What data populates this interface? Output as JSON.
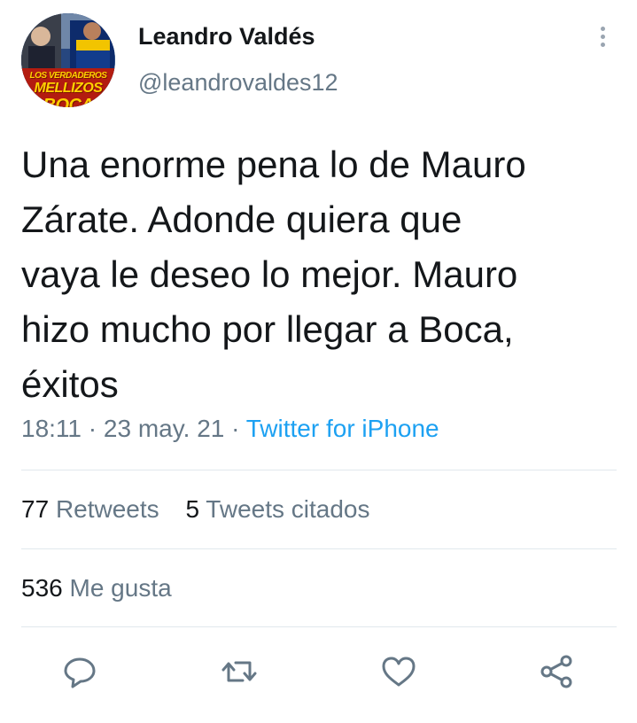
{
  "author": {
    "name": "Leandro Valdés",
    "handle": "@leandrovaldes12",
    "avatar_icon": "profile-picture-boca-collage",
    "avatar_text": [
      "LOS VERDADEROS",
      "MELLIZOS",
      "BOCA"
    ]
  },
  "tweet": {
    "text": "Una enorme pena lo de Mauro\nZárate. Adonde quiera que\nvaya le deseo lo mejor. Mauro\nhizo mucho por llegar a Boca,\néxitos",
    "time": "18:11",
    "sep1": "·",
    "date": "23 may. 21",
    "sep2": "·",
    "source": "Twitter for iPhone"
  },
  "stats": {
    "retweets_count": "77",
    "retweets_label": "Retweets",
    "quotes_count": "5",
    "quotes_label": "Tweets citados",
    "likes_count": "536",
    "likes_label": "Me gusta"
  },
  "actions": [
    {
      "icon": "reply-icon"
    },
    {
      "icon": "retweet-icon"
    },
    {
      "icon": "like-icon"
    },
    {
      "icon": "share-icon"
    }
  ],
  "colors": {
    "text": "#14171a",
    "secondary": "#657786",
    "link": "#1da1f2",
    "divider": "#e1e8ed"
  }
}
